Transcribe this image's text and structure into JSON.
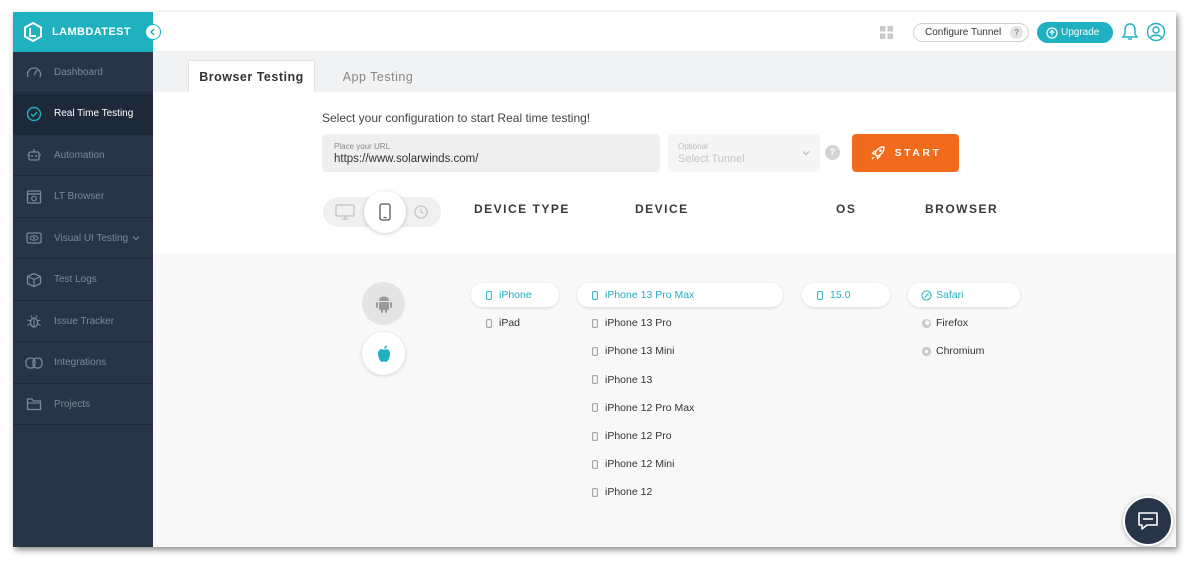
{
  "app": {
    "brand": "LAMBDATEST"
  },
  "sidebar": {
    "items": [
      {
        "label": "Dashboard",
        "icon": "dashboard-icon"
      },
      {
        "label": "Real Time Testing",
        "icon": "clock-icon",
        "active": true
      },
      {
        "label": "Automation",
        "icon": "robot-icon"
      },
      {
        "label": "LT Browser",
        "icon": "browser-icon"
      },
      {
        "label": "Visual UI Testing",
        "icon": "eye-icon"
      },
      {
        "label": "Test Logs",
        "icon": "box-icon"
      },
      {
        "label": "Issue Tracker",
        "icon": "bug-icon"
      },
      {
        "label": "Integrations",
        "icon": "integrations-icon"
      },
      {
        "label": "Projects",
        "icon": "folder-icon"
      }
    ]
  },
  "header": {
    "configure_tunnel": "Configure Tunnel",
    "tunnel_help": "?",
    "upgrade": "Upgrade"
  },
  "tabs": [
    {
      "label": "Browser Testing",
      "active": true
    },
    {
      "label": "App Testing",
      "active": false
    }
  ],
  "config": {
    "subtitle": "Select your configuration to start Real time testing!",
    "url": {
      "placeholder": "Place your URL",
      "value": "https://www.solarwinds.com/"
    },
    "tunnel": {
      "optional_label": "Optional",
      "value": "Select Tunnel"
    },
    "help": "?",
    "start": "START"
  },
  "columns": {
    "device_type": "DEVICE TYPE",
    "device": "DEVICE",
    "os": "OS",
    "browser": "BROWSER"
  },
  "device_types": [
    {
      "label": "iPhone",
      "selected": true
    },
    {
      "label": "iPad",
      "selected": false
    }
  ],
  "devices": [
    {
      "label": "iPhone 13 Pro Max",
      "selected": true
    },
    {
      "label": "iPhone 13 Pro",
      "selected": false
    },
    {
      "label": "iPhone 13 Mini",
      "selected": false
    },
    {
      "label": "iPhone 13",
      "selected": false
    },
    {
      "label": "iPhone 12 Pro Max",
      "selected": false
    },
    {
      "label": "iPhone 12 Pro",
      "selected": false
    },
    {
      "label": "iPhone 12 Mini",
      "selected": false
    },
    {
      "label": "iPhone 12",
      "selected": false
    }
  ],
  "os_versions": [
    {
      "label": "15.0",
      "selected": true
    }
  ],
  "browsers": [
    {
      "label": "Safari",
      "selected": true
    },
    {
      "label": "Firefox",
      "selected": false
    },
    {
      "label": "Chromium",
      "selected": false
    }
  ],
  "colors": {
    "accent": "#1fb1bf",
    "sidebar": "#283548",
    "start": "#f26a1b"
  }
}
